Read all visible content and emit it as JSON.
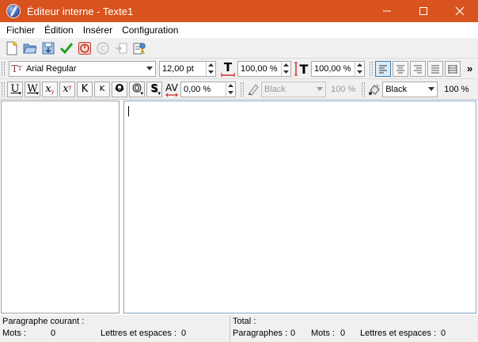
{
  "window": {
    "title": "Éditeur interne - Texte1",
    "accent": "#d9531e"
  },
  "menu": [
    "Fichier",
    "Édition",
    "Insérer",
    "Configuration"
  ],
  "toolbar1": {
    "icons": [
      "new-document-icon",
      "open-folder-icon",
      "save-icon",
      "checkmark-icon",
      "stop-icon",
      "copyright-icon",
      "insert-icon",
      "properties-icon"
    ]
  },
  "toolbar2": {
    "font": "Arial Regular",
    "font_size": "12,00 pt",
    "width_scale": "100,00 %",
    "height_scale": "100,00 %",
    "more": "»"
  },
  "toolbar3": {
    "format_buttons": [
      "U",
      "W",
      "x",
      "x",
      "K",
      "K",
      "O",
      "O",
      "S"
    ],
    "tracking": "0,00 %",
    "stroke_color": "Black",
    "stroke_percent": "100 %",
    "fill_color": "Black",
    "fill_percent": "100 %"
  },
  "status": {
    "current_paragraph_label": "Paragraphe courant :",
    "words_label": "Mots :",
    "words_value": "0",
    "letters_label": "Lettres et espaces :",
    "letters_value": "0",
    "total_label": "Total :",
    "paragraphs_label": "Paragraphes :",
    "paragraphs_value": "0",
    "total_words_label": "Mots :",
    "total_words_value": "0",
    "total_letters_label": "Lettres et espaces :",
    "total_letters_value": "0"
  }
}
